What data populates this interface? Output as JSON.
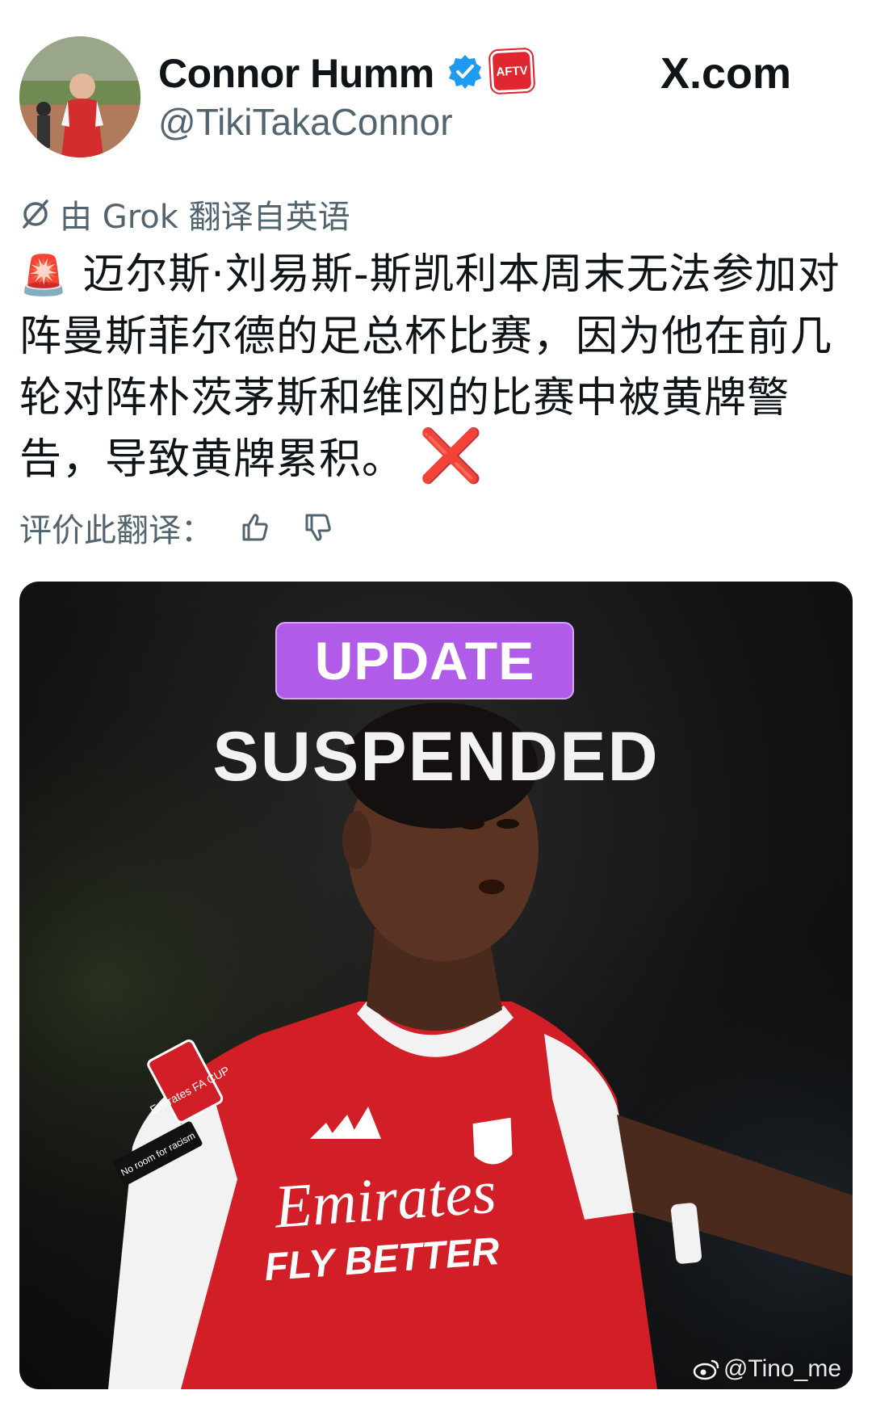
{
  "author": {
    "display_name": "Connor Humm",
    "handle": "@TikiTakaConnor",
    "badge_text": "AFTV"
  },
  "site": {
    "label": "X.com"
  },
  "translation": {
    "note": "由 Grok 翻译自英语"
  },
  "tweet": {
    "siren_emoji": "🚨",
    "text": "迈尔斯·刘易斯-斯凯利本周末无法参加对阵曼斯菲尔德的足总杯比赛，因为他在前几轮对阵朴茨茅斯和维冈的比赛中被黄牌警告，导致黄牌累积。",
    "cross_emoji": "❌"
  },
  "rate": {
    "label": "评价此翻译："
  },
  "media": {
    "badge": "UPDATE",
    "headline": "SUSPENDED",
    "jersey_sponsor": "Emirates",
    "jersey_slogan": "FLY BETTER",
    "sleeve_patch": "Emirates FA CUP",
    "sleeve_text": "No room for racism"
  },
  "watermark": "@Tino_me",
  "colors": {
    "badge_purple": "#b05ce8",
    "verified_blue": "#1d9bf0",
    "arsenal_red": "#e0262f"
  }
}
